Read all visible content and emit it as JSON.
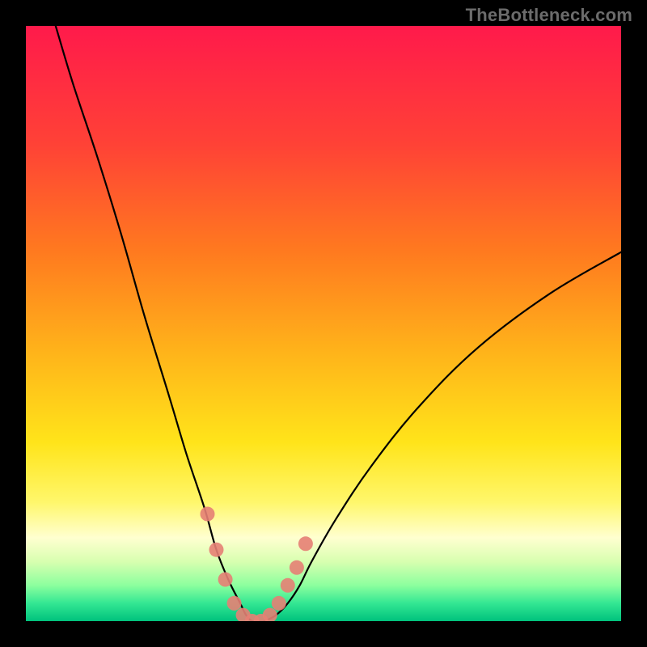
{
  "watermark": "TheBottleneck.com",
  "chart_data": {
    "type": "line",
    "title": "",
    "xlabel": "",
    "ylabel": "",
    "xlim": [
      0,
      100
    ],
    "ylim": [
      0,
      100
    ],
    "grid": false,
    "legend": false,
    "annotations": [],
    "background": {
      "type": "vertical-gradient",
      "stops": [
        {
          "pos": 0.0,
          "color": "#ff1a4b"
        },
        {
          "pos": 0.2,
          "color": "#ff4236"
        },
        {
          "pos": 0.38,
          "color": "#ff7a1f"
        },
        {
          "pos": 0.55,
          "color": "#ffb41a"
        },
        {
          "pos": 0.7,
          "color": "#ffe41a"
        },
        {
          "pos": 0.8,
          "color": "#fff76b"
        },
        {
          "pos": 0.86,
          "color": "#ffffd0"
        },
        {
          "pos": 0.9,
          "color": "#d8ffb0"
        },
        {
          "pos": 0.94,
          "color": "#8cff9e"
        },
        {
          "pos": 0.97,
          "color": "#33e793"
        },
        {
          "pos": 1.0,
          "color": "#00c27d"
        }
      ]
    },
    "series": [
      {
        "name": "bottleneck-curve",
        "color": "#000000",
        "x": [
          5,
          8,
          12,
          16,
          20,
          24,
          27,
          30,
          32,
          34,
          36,
          37,
          38,
          39,
          40,
          42,
          44,
          46,
          48,
          52,
          58,
          66,
          76,
          88,
          100
        ],
        "y": [
          100,
          90,
          78,
          65,
          51,
          38,
          28,
          19,
          12,
          7,
          3,
          1,
          0,
          0,
          0,
          1,
          3,
          6,
          10,
          17,
          26,
          36,
          46,
          55,
          62
        ]
      },
      {
        "name": "marker-dots",
        "color": "#e58074",
        "type": "scatter",
        "x": [
          30.5,
          32.0,
          33.5,
          35.0,
          36.5,
          38.0,
          39.5,
          41.0,
          42.5,
          44.0,
          45.5,
          47.0
        ],
        "y": [
          18,
          12,
          7,
          3,
          1,
          0,
          0,
          1,
          3,
          6,
          9,
          13
        ]
      }
    ],
    "notes": "Axes are unlabeled in the source image; x and y are normalized 0–100 estimates read off the plot geometry. The curve is a V-shaped bottleneck plot with a minimum near x≈38, overlaid on a vertical red→yellow→green gradient. Pink dots cluster around the minimum."
  }
}
